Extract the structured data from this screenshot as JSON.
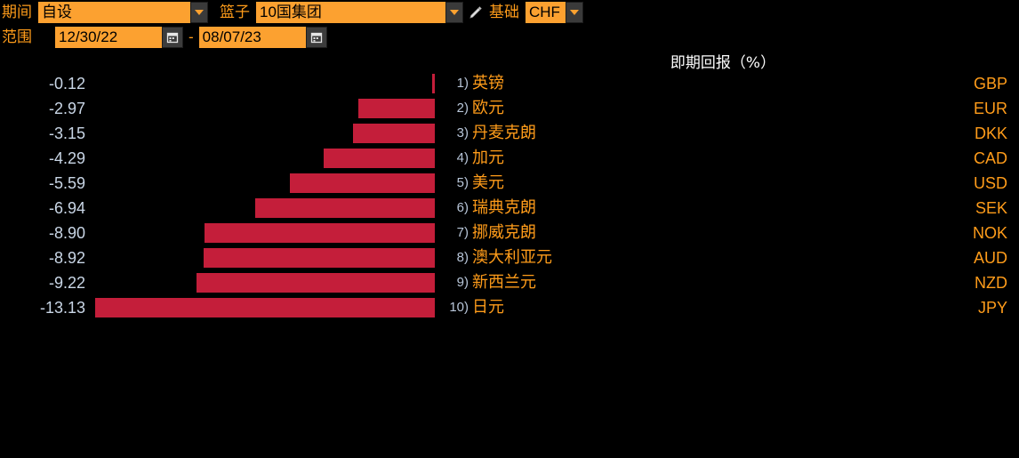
{
  "toolbar": {
    "period_label": "期间",
    "period_value": "自设",
    "basket_label": "篮子",
    "basket_value": "10国集团",
    "edit_icon": "pencil-icon",
    "base_label": "基础",
    "base_value": "CHF",
    "range_label": "范围",
    "range_start": "12/30/22",
    "range_end": "08/07/23",
    "range_separator": "-",
    "dropdown_icon": "chevron-down-icon",
    "calendar_icon": "calendar-icon"
  },
  "colors": {
    "background": "#000000",
    "accent_orange": "#ff9c1a",
    "field_orange": "#fca130",
    "bar_red": "#c41e3a",
    "value_text": "#c9d6e6",
    "title_text": "#ffffff"
  },
  "chart_data": {
    "type": "bar",
    "orientation": "horizontal",
    "title": "即期回报（%）",
    "xlabel": "",
    "ylabel": "",
    "xlim": [
      -13.13,
      0
    ],
    "grid": false,
    "legend": false,
    "categories": [
      "英镑",
      "欧元",
      "丹麦克朗",
      "加元",
      "美元",
      "瑞典克朗",
      "挪威克朗",
      "澳大利亚元",
      "新西兰元",
      "日元"
    ],
    "values": [
      -0.12,
      -2.97,
      -3.15,
      -4.29,
      -5.59,
      -6.94,
      -8.9,
      -8.92,
      -9.22,
      -13.13
    ],
    "value_labels": [
      "-0.12",
      "-2.97",
      "-3.15",
      "-4.29",
      "-5.59",
      "-6.94",
      "-8.90",
      "-8.92",
      "-9.22",
      "-13.13"
    ],
    "ranks": [
      "1)",
      "2)",
      "3)",
      "4)",
      "5)",
      "6)",
      "7)",
      "8)",
      "9)",
      "10)"
    ],
    "tickers": [
      "GBP",
      "EUR",
      "DKK",
      "CAD",
      "USD",
      "SEK",
      "NOK",
      "AUD",
      "NZD",
      "JPY"
    ]
  }
}
